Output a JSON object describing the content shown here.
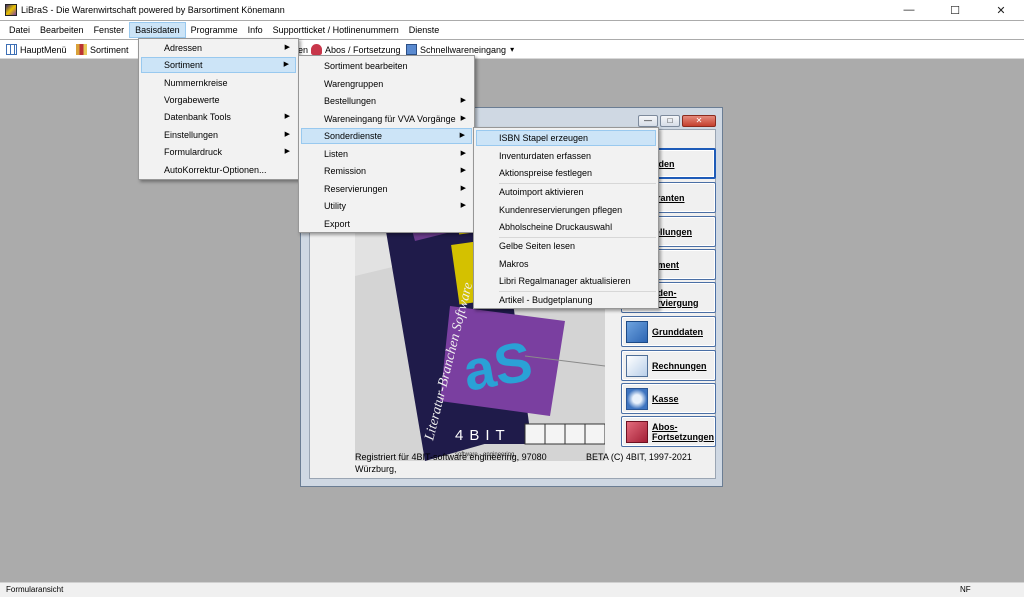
{
  "window": {
    "title": "LiBraS - Die Warenwirtschaft powered by Barsortiment Könemann"
  },
  "menubar": [
    "Datei",
    "Bearbeiten",
    "Fenster",
    "Basisdaten",
    "Programme",
    "Info",
    "Supportticket / Hotlinenummern",
    "Dienste"
  ],
  "toolbar": {
    "hauptmenu": "HauptMenü",
    "sortiment": "Sortiment",
    "partial": "en",
    "abos": "Abos / Fortsetzung",
    "schnell": "Schnellwareneingang"
  },
  "menu_basisdaten": [
    "Adressen",
    "Sortiment",
    "Nummernkreise",
    "Vorgabewerte",
    "Datenbank Tools",
    "Einstellungen",
    "Formulardruck",
    "AutoKorrektur-Optionen..."
  ],
  "menu_sortiment": [
    "Sortiment bearbeiten",
    "Warengruppen",
    "Bestellungen",
    "Wareneingang für VVA Vorgänge",
    "Sonderdienste",
    "Listen",
    "Remission",
    "Reservierungen",
    "Utility",
    "Export"
  ],
  "menu_sonderdienste": [
    "ISBN Stapel erzeugen",
    "Inventurdaten erfassen",
    "Aktionspreise festlegen",
    "Autoimport aktivieren",
    "Kundenreservierungen pflegen",
    "Abholscheine Druckauswahl",
    "Gelbe Seiten lesen",
    "Makros",
    "Libri Regalmanager aktualisieren",
    "Artikel - Budgetplanung"
  ],
  "mainwin": {
    "buttons_partial": [
      "nden",
      "eranten",
      "tellungen",
      "timent",
      "nden-",
      "erviergung"
    ],
    "buttons": [
      "Grunddaten",
      "Rechnungen",
      "Kasse",
      "Abos-",
      "Fortsetzungen"
    ],
    "reg_line1": "Registriert für 4BIT-software engineering, 97080",
    "reg_line2": "Würzburg,",
    "beta": "BETA (C)  4BIT, 1997-2021",
    "logo_text": "4BIT",
    "logo_sub": "software - engineering",
    "splash_text": "Literatur-Branchen Software"
  },
  "status": {
    "left": "Formularansicht",
    "right": "NF"
  }
}
